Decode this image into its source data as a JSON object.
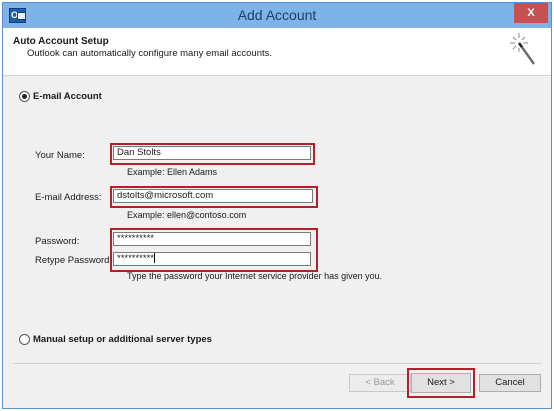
{
  "window": {
    "title": "Add Account",
    "close_glyph": "X"
  },
  "app_icon": {
    "name": "outlook-icon",
    "letter": "O"
  },
  "header": {
    "title": "Auto Account Setup",
    "subtitle": "Outlook can automatically configure many email accounts.",
    "icon": "magic-wand-icon"
  },
  "options": {
    "email_account": {
      "label": "E-mail Account",
      "selected": true
    },
    "manual_setup": {
      "label": "Manual setup or additional server types",
      "selected": false
    }
  },
  "form": {
    "name": {
      "label": "Your Name:",
      "value": "Dan Stolts",
      "hint": "Example: Ellen Adams"
    },
    "email": {
      "label": "E-mail Address:",
      "value": "dstolts@microsoft.com",
      "hint": "Example: ellen@contoso.com"
    },
    "password": {
      "label": "Password:",
      "value": "**********"
    },
    "retype_password": {
      "label": "Retype Password:",
      "value": "**********"
    },
    "password_hint": "Type the password your Internet service provider has given you."
  },
  "buttons": {
    "back": "< Back",
    "next": "Next >",
    "cancel": "Cancel"
  },
  "colors": {
    "title_bar": "#7eb3e8",
    "close_button": "#c75050",
    "highlight": "#b3202a"
  }
}
